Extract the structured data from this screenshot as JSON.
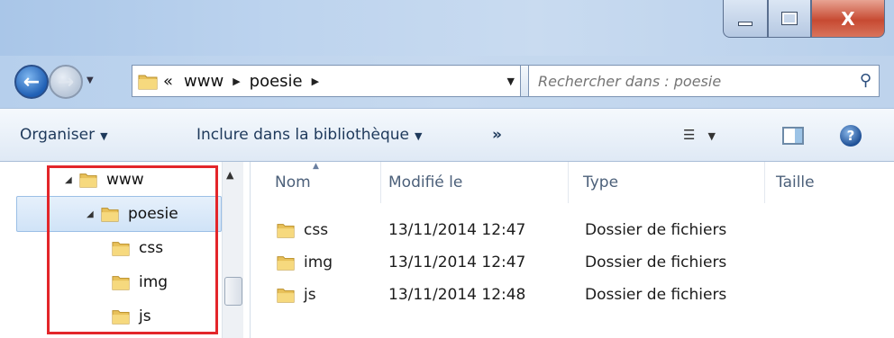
{
  "window": {
    "close_label": "X"
  },
  "address": {
    "overflow": "«",
    "crumbs": [
      "www",
      "poesie"
    ]
  },
  "search": {
    "placeholder": "Rechercher dans : poesie"
  },
  "toolbar": {
    "organize": "Organiser",
    "include_library": "Inclure dans la bibliothèque",
    "more": "»"
  },
  "tree": {
    "items": [
      {
        "label": "www",
        "expanded": true
      },
      {
        "label": "poesie",
        "expanded": true,
        "selected": true
      },
      {
        "label": "css"
      },
      {
        "label": "img"
      },
      {
        "label": "js"
      }
    ]
  },
  "columns": {
    "name": "Nom",
    "modified": "Modifié le",
    "type": "Type",
    "size": "Taille"
  },
  "files": [
    {
      "name": "css",
      "modified": "13/11/2014 12:47",
      "type": "Dossier de fichiers"
    },
    {
      "name": "img",
      "modified": "13/11/2014 12:47",
      "type": "Dossier de fichiers"
    },
    {
      "name": "js",
      "modified": "13/11/2014 12:48",
      "type": "Dossier de fichiers"
    }
  ],
  "colors": {
    "highlight_border": "#e3262a",
    "selection": "#d0e3f7",
    "folder": "#e8c15a"
  }
}
